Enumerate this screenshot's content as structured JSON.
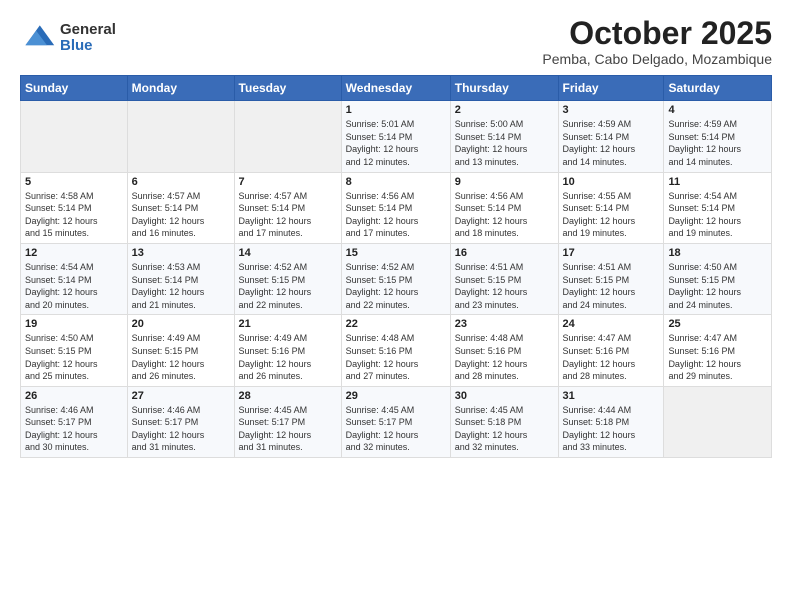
{
  "logo": {
    "general": "General",
    "blue": "Blue"
  },
  "header": {
    "month": "October 2025",
    "location": "Pemba, Cabo Delgado, Mozambique"
  },
  "weekdays": [
    "Sunday",
    "Monday",
    "Tuesday",
    "Wednesday",
    "Thursday",
    "Friday",
    "Saturday"
  ],
  "weeks": [
    [
      {
        "day": "",
        "info": ""
      },
      {
        "day": "",
        "info": ""
      },
      {
        "day": "",
        "info": ""
      },
      {
        "day": "1",
        "info": "Sunrise: 5:01 AM\nSunset: 5:14 PM\nDaylight: 12 hours\nand 12 minutes."
      },
      {
        "day": "2",
        "info": "Sunrise: 5:00 AM\nSunset: 5:14 PM\nDaylight: 12 hours\nand 13 minutes."
      },
      {
        "day": "3",
        "info": "Sunrise: 4:59 AM\nSunset: 5:14 PM\nDaylight: 12 hours\nand 14 minutes."
      },
      {
        "day": "4",
        "info": "Sunrise: 4:59 AM\nSunset: 5:14 PM\nDaylight: 12 hours\nand 14 minutes."
      }
    ],
    [
      {
        "day": "5",
        "info": "Sunrise: 4:58 AM\nSunset: 5:14 PM\nDaylight: 12 hours\nand 15 minutes."
      },
      {
        "day": "6",
        "info": "Sunrise: 4:57 AM\nSunset: 5:14 PM\nDaylight: 12 hours\nand 16 minutes."
      },
      {
        "day": "7",
        "info": "Sunrise: 4:57 AM\nSunset: 5:14 PM\nDaylight: 12 hours\nand 17 minutes."
      },
      {
        "day": "8",
        "info": "Sunrise: 4:56 AM\nSunset: 5:14 PM\nDaylight: 12 hours\nand 17 minutes."
      },
      {
        "day": "9",
        "info": "Sunrise: 4:56 AM\nSunset: 5:14 PM\nDaylight: 12 hours\nand 18 minutes."
      },
      {
        "day": "10",
        "info": "Sunrise: 4:55 AM\nSunset: 5:14 PM\nDaylight: 12 hours\nand 19 minutes."
      },
      {
        "day": "11",
        "info": "Sunrise: 4:54 AM\nSunset: 5:14 PM\nDaylight: 12 hours\nand 19 minutes."
      }
    ],
    [
      {
        "day": "12",
        "info": "Sunrise: 4:54 AM\nSunset: 5:14 PM\nDaylight: 12 hours\nand 20 minutes."
      },
      {
        "day": "13",
        "info": "Sunrise: 4:53 AM\nSunset: 5:14 PM\nDaylight: 12 hours\nand 21 minutes."
      },
      {
        "day": "14",
        "info": "Sunrise: 4:52 AM\nSunset: 5:15 PM\nDaylight: 12 hours\nand 22 minutes."
      },
      {
        "day": "15",
        "info": "Sunrise: 4:52 AM\nSunset: 5:15 PM\nDaylight: 12 hours\nand 22 minutes."
      },
      {
        "day": "16",
        "info": "Sunrise: 4:51 AM\nSunset: 5:15 PM\nDaylight: 12 hours\nand 23 minutes."
      },
      {
        "day": "17",
        "info": "Sunrise: 4:51 AM\nSunset: 5:15 PM\nDaylight: 12 hours\nand 24 minutes."
      },
      {
        "day": "18",
        "info": "Sunrise: 4:50 AM\nSunset: 5:15 PM\nDaylight: 12 hours\nand 24 minutes."
      }
    ],
    [
      {
        "day": "19",
        "info": "Sunrise: 4:50 AM\nSunset: 5:15 PM\nDaylight: 12 hours\nand 25 minutes."
      },
      {
        "day": "20",
        "info": "Sunrise: 4:49 AM\nSunset: 5:15 PM\nDaylight: 12 hours\nand 26 minutes."
      },
      {
        "day": "21",
        "info": "Sunrise: 4:49 AM\nSunset: 5:16 PM\nDaylight: 12 hours\nand 26 minutes."
      },
      {
        "day": "22",
        "info": "Sunrise: 4:48 AM\nSunset: 5:16 PM\nDaylight: 12 hours\nand 27 minutes."
      },
      {
        "day": "23",
        "info": "Sunrise: 4:48 AM\nSunset: 5:16 PM\nDaylight: 12 hours\nand 28 minutes."
      },
      {
        "day": "24",
        "info": "Sunrise: 4:47 AM\nSunset: 5:16 PM\nDaylight: 12 hours\nand 28 minutes."
      },
      {
        "day": "25",
        "info": "Sunrise: 4:47 AM\nSunset: 5:16 PM\nDaylight: 12 hours\nand 29 minutes."
      }
    ],
    [
      {
        "day": "26",
        "info": "Sunrise: 4:46 AM\nSunset: 5:17 PM\nDaylight: 12 hours\nand 30 minutes."
      },
      {
        "day": "27",
        "info": "Sunrise: 4:46 AM\nSunset: 5:17 PM\nDaylight: 12 hours\nand 31 minutes."
      },
      {
        "day": "28",
        "info": "Sunrise: 4:45 AM\nSunset: 5:17 PM\nDaylight: 12 hours\nand 31 minutes."
      },
      {
        "day": "29",
        "info": "Sunrise: 4:45 AM\nSunset: 5:17 PM\nDaylight: 12 hours\nand 32 minutes."
      },
      {
        "day": "30",
        "info": "Sunrise: 4:45 AM\nSunset: 5:18 PM\nDaylight: 12 hours\nand 32 minutes."
      },
      {
        "day": "31",
        "info": "Sunrise: 4:44 AM\nSunset: 5:18 PM\nDaylight: 12 hours\nand 33 minutes."
      },
      {
        "day": "",
        "info": ""
      }
    ]
  ]
}
